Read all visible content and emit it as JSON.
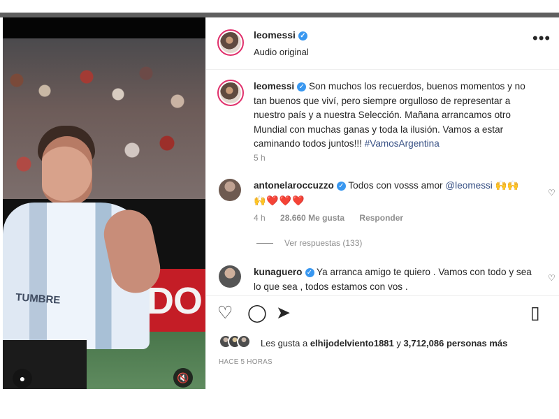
{
  "post": {
    "username": "leomessi",
    "audio_label": "Audio original",
    "more_label": "•••",
    "caption": {
      "username": "leomessi",
      "text": "Son muchos los recuerdos, buenos momentos y no tan buenos que viví, pero siempre orgulloso de representar a nuestro país y a nuestra Selección. Mañana arrancamos otro Mundial con muchas ganas y toda la ilusión. Vamos a estar caminando todos juntos!!! ",
      "hashtag": "#VamosArgentina",
      "time": "5 h"
    }
  },
  "comments": [
    {
      "username": "antonelaroccuzzo",
      "text": "Todos con vosss amor ",
      "mention": "@leomessi",
      "emojis": "🙌🙌",
      "emojis_line2": "🙌❤️❤️❤️",
      "time": "4 h",
      "likes": "28.660 Me gusta",
      "reply": "Responder"
    },
    {
      "username": "kunaguero",
      "text": "Ya arranca amigo te quiero . Vamos con todo y sea lo que sea , todos estamos con vos ."
    }
  ],
  "replies": "Ver respuestas (133)",
  "likes": {
    "prefix": "Les gusta a ",
    "user": "elhijodelviento1881",
    "middle": " y ",
    "count": "3,712,086",
    "suffix": " personas más"
  },
  "posted_ago": "HACE 5 HORAS",
  "video_overlay": {
    "ad_text": "ACDO",
    "shirt_text": "TUMBRE"
  },
  "icons": {
    "verified": "verified-badge-icon",
    "like": "heart-icon",
    "comment": "comment-icon",
    "share": "paper-plane-icon",
    "save": "bookmark-icon",
    "mute": "muted-speaker-icon",
    "user": "user-icon"
  },
  "colors": {
    "link": "#385185",
    "verified": "#3897f0",
    "heart": "#d82f3c",
    "secondary_text": "#8e8e8e"
  }
}
